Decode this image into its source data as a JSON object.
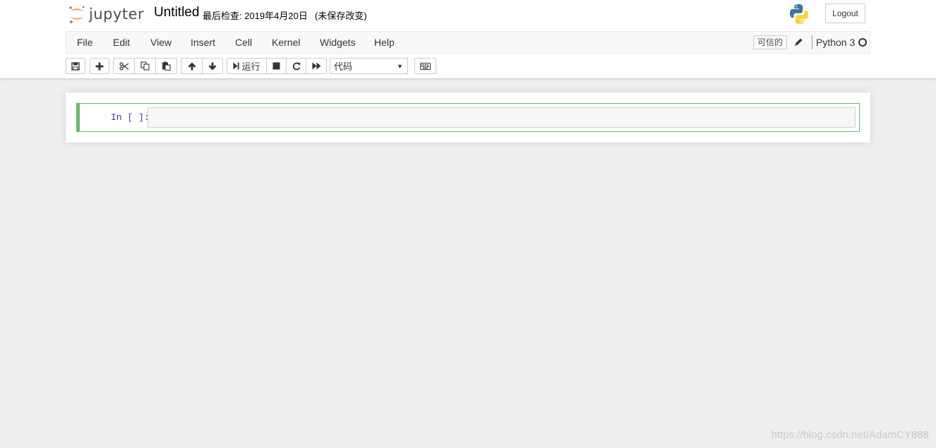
{
  "header": {
    "logo_text": "jupyter",
    "notebook_title": "Untitled",
    "checkpoint": "最后检查: 2019年4月20日",
    "autosave": "(未保存改变)",
    "logout_label": "Logout",
    "colors": {
      "logo_orange": "#f37726",
      "cell_border_green": "#66bb6a",
      "prompt_blue": "#303f9f"
    }
  },
  "menubar": {
    "items": [
      "File",
      "Edit",
      "View",
      "Insert",
      "Cell",
      "Kernel",
      "Widgets",
      "Help"
    ],
    "trusted_label": "可信的",
    "kernel_name": "Python 3"
  },
  "toolbar": {
    "run_label": "运行",
    "cell_type": "代码",
    "icons": [
      "save-icon",
      "plus-icon",
      "cut-icon",
      "copy-icon",
      "paste-icon",
      "arrow-up-icon",
      "arrow-down-icon",
      "run-icon",
      "stop-icon",
      "restart-icon",
      "fast-forward-icon",
      "keyboard-icon"
    ]
  },
  "notebook": {
    "cells": [
      {
        "prompt": "In [ ]:",
        "source": ""
      }
    ]
  },
  "watermark": "https://blog.csdn.net/AdamCY888"
}
